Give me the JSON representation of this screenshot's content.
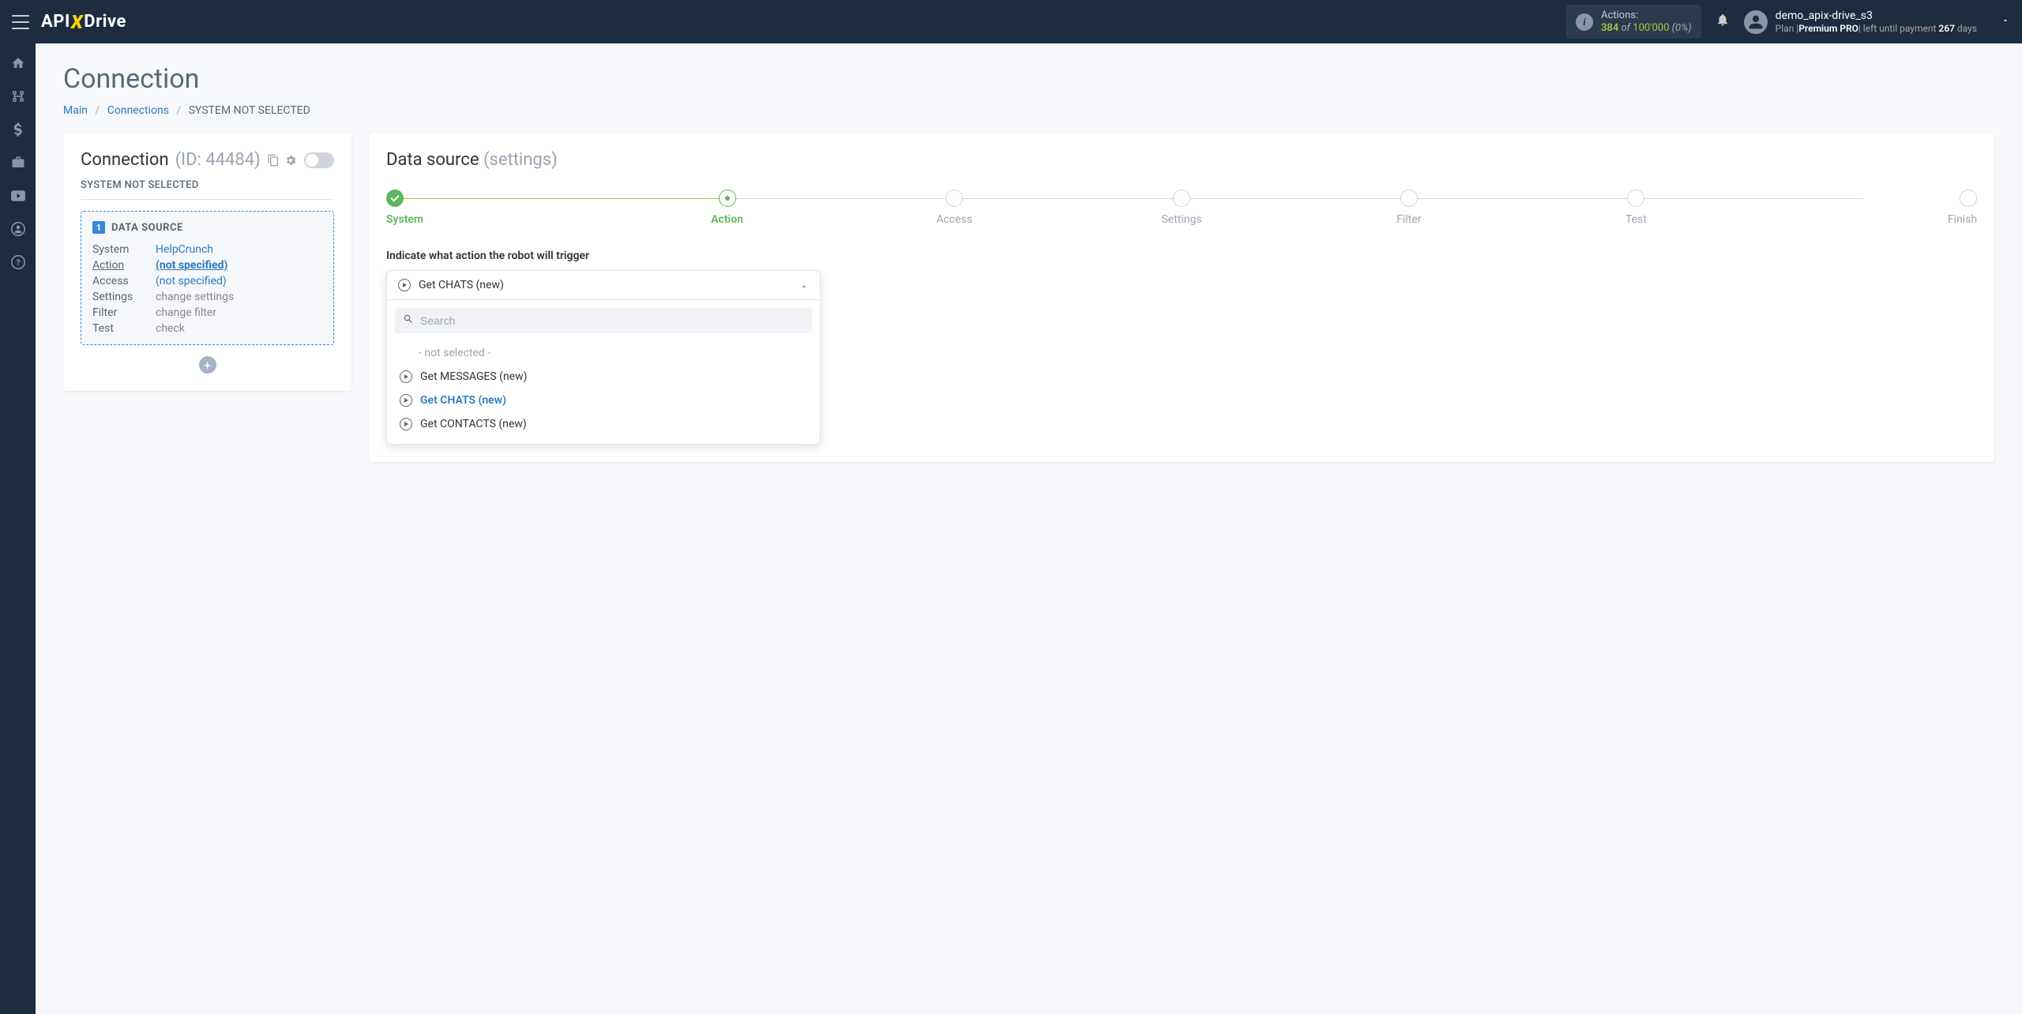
{
  "topbar": {
    "logo": {
      "part1": "API",
      "part2": "X",
      "part3": "Drive"
    },
    "actions": {
      "label": "Actions:",
      "count": "384",
      "of": "of",
      "total": "100'000",
      "pct": "(0%)"
    },
    "user": {
      "name": "demo_apix-drive_s3",
      "plan_prefix": "Plan |",
      "plan_name": "Premium PRO",
      "plan_mid": "| left until payment ",
      "days_count": "267",
      "days_suffix": " days"
    }
  },
  "page": {
    "title": "Connection",
    "crumbs": {
      "c1": "Main",
      "c2": "Connections",
      "c3": "SYSTEM NOT SELECTED"
    }
  },
  "left_panel": {
    "title": "Connection",
    "id": "(ID: 44484)",
    "subtitle": "SYSTEM NOT SELECTED",
    "datasource": {
      "num": "1",
      "label": "DATA SOURCE",
      "rows": {
        "system_k": "System",
        "system_v": "HelpCrunch",
        "action_k": "Action",
        "action_v": "(not specified)",
        "access_k": "Access",
        "access_v": "(not specified)",
        "settings_k": "Settings",
        "settings_v": "change settings",
        "filter_k": "Filter",
        "filter_v": "change filter",
        "test_k": "Test",
        "test_v": "check"
      }
    }
  },
  "right_panel": {
    "title": "Data source",
    "title_suffix": "(settings)",
    "steps": {
      "s1": "System",
      "s2": "Action",
      "s3": "Access",
      "s4": "Settings",
      "s5": "Filter",
      "s6": "Test",
      "s7": "Finish"
    },
    "field_label": "Indicate what action the robot will trigger",
    "dropdown": {
      "selected": "Get CHATS (new)",
      "search_placeholder": "Search",
      "not_selected": "- not selected -",
      "options": {
        "o1": "Get MESSAGES (new)",
        "o2": "Get CHATS (new)",
        "o3": "Get CONTACTS (new)"
      }
    }
  }
}
